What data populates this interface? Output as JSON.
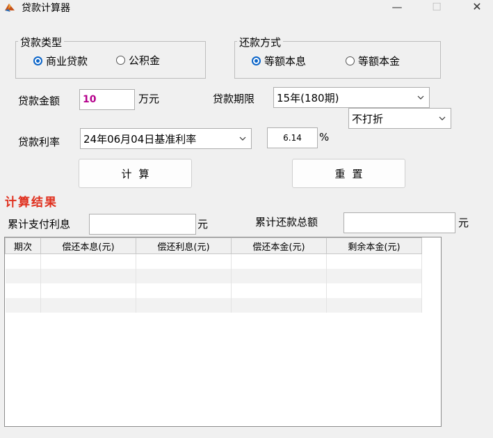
{
  "window": {
    "title": "贷款计算器",
    "minimize": "—",
    "maximize": "☐",
    "close": "✕"
  },
  "loan_type": {
    "legend": "贷款类型",
    "options": [
      "商业贷款",
      "公积金"
    ],
    "selected": "商业贷款"
  },
  "repay_method": {
    "legend": "还款方式",
    "options": [
      "等额本息",
      "等额本金"
    ],
    "selected": "等额本息"
  },
  "amount": {
    "label": "贷款金额",
    "value": "10",
    "unit": "万元"
  },
  "term": {
    "label": "贷款期限",
    "value": "15年(180期)"
  },
  "discount": {
    "value": "不打折"
  },
  "rate": {
    "label": "贷款利率",
    "value": "24年06月04日基准利率",
    "number": "6.14",
    "unit": "%"
  },
  "buttons": {
    "calc": "计算",
    "reset": "重置"
  },
  "results": {
    "title": "计算结果",
    "interest_label": "累计支付利息",
    "interest_value": "",
    "interest_unit": "元",
    "total_label": "累计还款总额",
    "total_value": "",
    "total_unit": "元"
  },
  "table": {
    "columns": [
      "期次",
      "偿还本息(元)",
      "偿还利息(元)",
      "偿还本金(元)",
      "剩余本金(元)"
    ],
    "rows": [
      [
        "",
        "",
        "",
        "",
        ""
      ],
      [
        "",
        "",
        "",
        "",
        ""
      ],
      [
        "",
        "",
        "",
        "",
        ""
      ],
      [
        "",
        "",
        "",
        "",
        ""
      ]
    ]
  }
}
